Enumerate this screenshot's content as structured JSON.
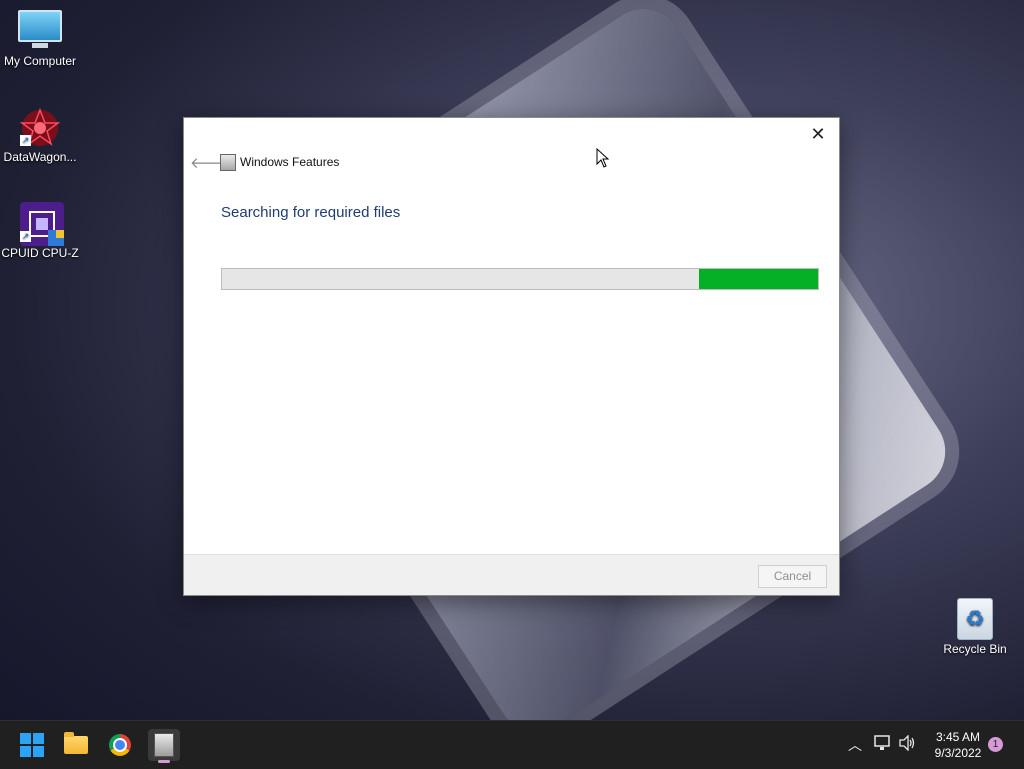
{
  "desktop": {
    "icons": [
      {
        "label": "My Computer"
      },
      {
        "label": "DataWagon..."
      },
      {
        "label": "CPUID CPU-Z"
      },
      {
        "label": "Recycle Bin"
      }
    ]
  },
  "window": {
    "title": "Windows Features",
    "heading": "Searching for required files",
    "progress_fraction": 0.2,
    "progress_color": "#06b025",
    "cancel_label": "Cancel",
    "icons": {
      "back": "back-arrow-icon",
      "close": "close-icon",
      "app": "windows-features-icon"
    }
  },
  "taskbar": {
    "apps": [
      "start-icon",
      "file-explorer-icon",
      "chrome-icon",
      "windows-features-icon"
    ],
    "tray": {
      "overflow": "chevron-up-icon",
      "network": "network-icon",
      "volume": "volume-icon"
    },
    "time": "3:45 AM",
    "date": "9/3/2022",
    "notification_count": "1"
  }
}
